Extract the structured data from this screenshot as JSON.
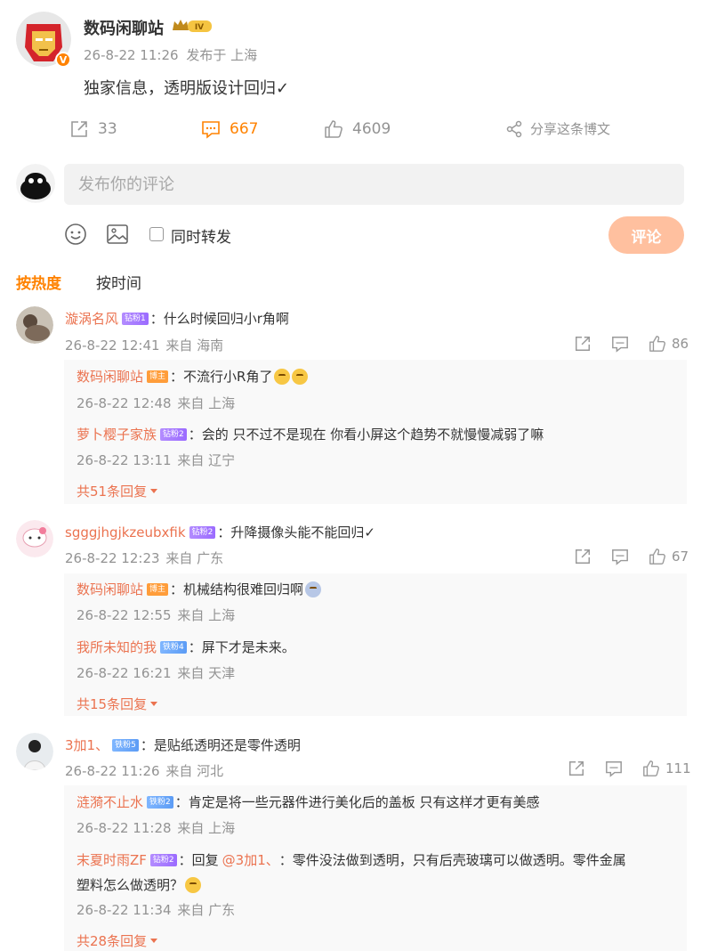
{
  "post": {
    "author": "数码闲聊站",
    "level_badge": "IV",
    "verified_mark": "V",
    "time": "26-8-22 11:26",
    "location_text": "发布于 上海",
    "text": "独家信息，透明版设计回归✓",
    "repost_count": "33",
    "comment_count": "667",
    "like_count": "4609",
    "share_label": "分享这条博文"
  },
  "composer": {
    "placeholder": "发布你的评论",
    "repost_label": "同时转发",
    "submit_label": "评论"
  },
  "sort_tabs": {
    "hot": "按热度",
    "time": "按时间"
  },
  "comments": [
    {
      "name": "漩涡名风",
      "badge": "钻粉1",
      "text": "什么时候回归小r角啊",
      "time": "26-8-22 12:41",
      "loc": "来自 海南",
      "likes": "86",
      "replies": [
        {
          "name": "数码闲聊站",
          "badge": "博主",
          "text": "不流行小R角了",
          "time": "26-8-22 12:48",
          "loc": "来自 上海"
        },
        {
          "name": "萝卜樱子家族",
          "badge": "钻粉2",
          "text": "会的 只不过不是现在 你看小屏这个趋势不就慢慢减弱了嘛",
          "time": "26-8-22 13:11",
          "loc": "来自 辽宁"
        }
      ],
      "more": "共51条回复"
    },
    {
      "name": "sgggjhgjkzeubxfik",
      "badge": "钻粉2",
      "text": "升降摄像头能不能回归✓",
      "time": "26-8-22 12:23",
      "loc": "来自 广东",
      "likes": "67",
      "replies": [
        {
          "name": "数码闲聊站",
          "badge": "博主",
          "text": "机械结构很难回归啊",
          "time": "26-8-22 12:55",
          "loc": "来自 上海"
        },
        {
          "name": "我所未知的我",
          "badge": "铁粉4",
          "text": "屏下才是未来。",
          "time": "26-8-22 16:21",
          "loc": "来自 天津"
        }
      ],
      "more": "共15条回复"
    },
    {
      "name": "3加1、",
      "badge": "铁粉5",
      "text": "是贴纸透明还是零件透明",
      "time": "26-8-22 11:26",
      "loc": "来自 河北",
      "likes": "111",
      "replies": [
        {
          "name": "涟漪不止水",
          "badge": "铁粉2",
          "text": "肯定是将一些元器件进行美化后的盖板 只有这样才更有美感",
          "time": "26-8-22 11:28",
          "loc": "来自 上海"
        },
        {
          "name": "末夏时雨ZF",
          "badge": "钻粉2",
          "reply_prefix": "回复",
          "mention": "@3加1、",
          "text": "零件没法做到透明，只有后壳玻璃可以做透明。零件金属",
          "text2": "塑料怎么做透明？",
          "time": "26-8-22 11:34",
          "loc": "来自 广东"
        }
      ],
      "more": "共28条回复"
    }
  ],
  "colors": {
    "accent": "#ff8200",
    "link": "#eb7350",
    "muted": "#939393",
    "submit_bg": "#ffc09f"
  }
}
